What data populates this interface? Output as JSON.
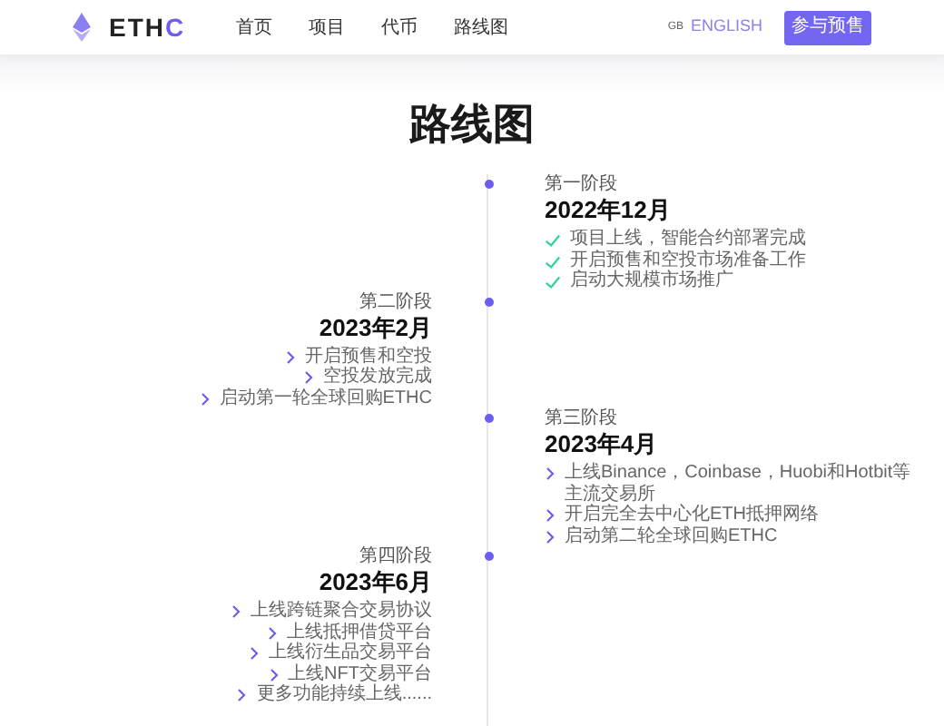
{
  "header": {
    "logo": {
      "text": "ETH",
      "accent": "C"
    },
    "nav": [
      "首页",
      "项目",
      "代币",
      "路线图"
    ],
    "language": {
      "code": "GB",
      "label": "ENGLISH"
    },
    "cta": "参与预售"
  },
  "title": "路线图",
  "phases": [
    {
      "kind": "check",
      "label": "第一阶段",
      "date": "2022年12月",
      "items": [
        "项目上线，智能合约部署完成",
        "开启预售和空投市场准备工作",
        "启动大规模市场推广"
      ]
    },
    {
      "kind": "chevron",
      "label": "第二阶段",
      "date": "2023年2月",
      "items": [
        "开启预售和空投",
        "空投发放完成",
        "启动第一轮全球回购ETHC"
      ]
    },
    {
      "kind": "chevron",
      "label": "第三阶段",
      "date": "2023年4月",
      "items": [
        "上线Binance，Coinbase，Huobi和Hotbit等主流交易所",
        "开启完全去中心化ETH抵押网络",
        "启动第二轮全球回购ETHC"
      ]
    },
    {
      "kind": "chevron",
      "label": "第四阶段",
      "date": "2023年6月",
      "items": [
        "上线跨链聚合交易协议",
        "上线抵押借贷平台",
        "上线衍生品交易平台",
        "上线NFT交易平台",
        "更多功能持续上线......"
      ]
    }
  ]
}
